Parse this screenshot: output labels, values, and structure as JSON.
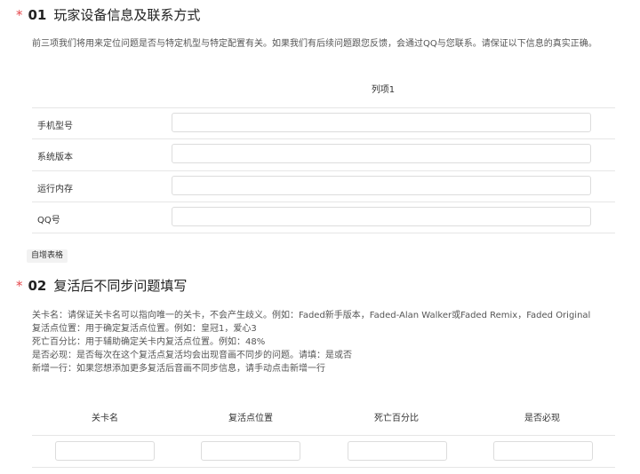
{
  "section1": {
    "required_mark": "*",
    "number": "01",
    "title": "玩家设备信息及联系方式",
    "description": "前三项我们将用来定位问题是否与特定机型与特定配置有关。如果我们有后续问题跟您反馈，会通过QQ与您联系。请保证以下信息的真实正确。",
    "column_header": "列项1",
    "rows": [
      {
        "label": "手机型号",
        "value": ""
      },
      {
        "label": "系统版本",
        "value": ""
      },
      {
        "label": "运行内存",
        "value": ""
      },
      {
        "label": "QQ号",
        "value": ""
      }
    ],
    "add_table_label": "自增表格"
  },
  "section2": {
    "required_mark": "*",
    "number": "02",
    "title": "复活后不同步问题填写",
    "description_lines": [
      "关卡名：请保证关卡名可以指向唯一的关卡，不会产生歧义。例如：Faded新手版本，Faded-Alan Walker或Faded Remix，Faded Original",
      "复活点位置：用于确定复活点位置。例如：皇冠1，爱心3",
      "死亡百分比：用于辅助确定关卡内复活点位置。例如：48%",
      "是否必现：是否每次在这个复活点复活均会出现音画不同步的问题。请填：是或否",
      "新增一行：如果您想添加更多复活后音画不同步信息，请手动点击新增一行"
    ],
    "columns": [
      "关卡名",
      "复活点位置",
      "死亡百分比",
      "是否必现"
    ]
  }
}
